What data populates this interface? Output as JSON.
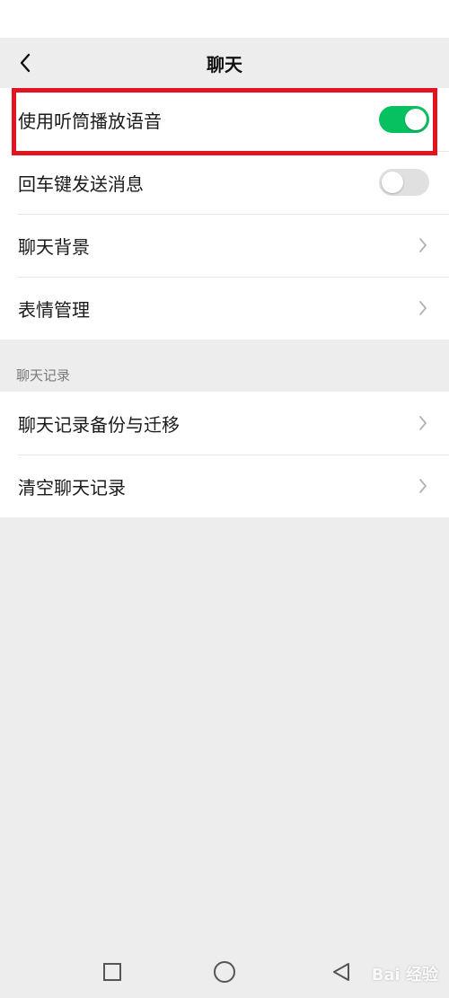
{
  "header": {
    "title": "聊天",
    "back_icon": "chevron-left-icon"
  },
  "settings": {
    "use_earpiece": {
      "label": "使用听筒播放语音",
      "enabled": true
    },
    "enter_to_send": {
      "label": "回车键发送消息",
      "enabled": false
    },
    "chat_background": {
      "label": "聊天背景"
    },
    "sticker_management": {
      "label": "表情管理"
    }
  },
  "chat_history_section": {
    "header": "聊天记录",
    "backup": {
      "label": "聊天记录备份与迁移"
    },
    "clear": {
      "label": "清空聊天记录"
    }
  },
  "system_nav": {
    "recent": "square-icon",
    "home": "circle-icon",
    "back": "triangle-back-icon"
  },
  "watermark": {
    "text": "Bai 经验"
  },
  "colors": {
    "toggle_on": "#07c160",
    "toggle_off": "#e0e0e0",
    "highlight": "#e3131f",
    "background": "#ededed"
  }
}
